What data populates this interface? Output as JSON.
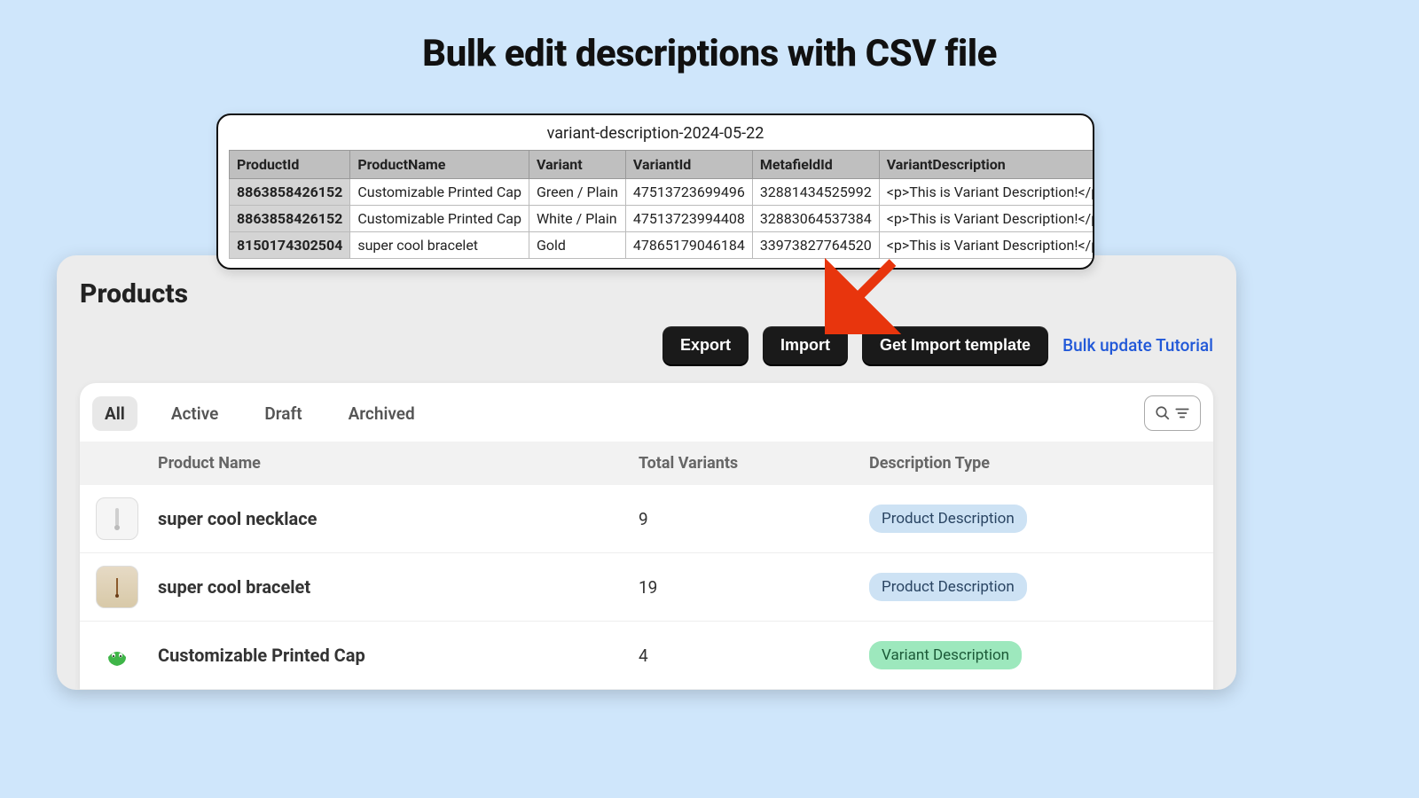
{
  "page": {
    "title": "Bulk edit descriptions with CSV file"
  },
  "csv": {
    "filename": "variant-description-2024-05-22",
    "headers": [
      "ProductId",
      "ProductName",
      "Variant",
      "VariantId",
      "MetafieldId",
      "VariantDescription"
    ],
    "rows": [
      {
        "productId": "8863858426152",
        "productName": "Customizable Printed Cap",
        "variant": "Green / Plain",
        "variantId": "47513723699496",
        "metafieldId": "32881434525992",
        "description": "<p>This is Variant Description!</p>"
      },
      {
        "productId": "8863858426152",
        "productName": "Customizable Printed Cap",
        "variant": "White / Plain",
        "variantId": "47513723994408",
        "metafieldId": "32883064537384",
        "description": "<p>This is Variant Description!</p>"
      },
      {
        "productId": "8150174302504",
        "productName": "super cool bracelet",
        "variant": "Gold",
        "variantId": "47865179046184",
        "metafieldId": "33973827764520",
        "description": "<p>This is Variant Description!</p>"
      }
    ]
  },
  "panel": {
    "heading": "Products",
    "buttons": {
      "export": "Export",
      "import": "Import",
      "template": "Get Import template"
    },
    "tutorial_link": "Bulk update Tutorial",
    "tabs": [
      "All",
      "Active",
      "Draft",
      "Archived"
    ],
    "columns": {
      "name": "Product Name",
      "variants": "Total Variants",
      "type": "Description Type"
    },
    "products": [
      {
        "name": "super cool necklace",
        "variants": "9",
        "type": "Product Description",
        "badge": "blue",
        "icon": "necklace"
      },
      {
        "name": "super cool bracelet",
        "variants": "19",
        "type": "Product Description",
        "badge": "blue",
        "icon": "bracelet"
      },
      {
        "name": "Customizable Printed Cap",
        "variants": "4",
        "type": "Variant Description",
        "badge": "green",
        "icon": "cap"
      }
    ]
  }
}
